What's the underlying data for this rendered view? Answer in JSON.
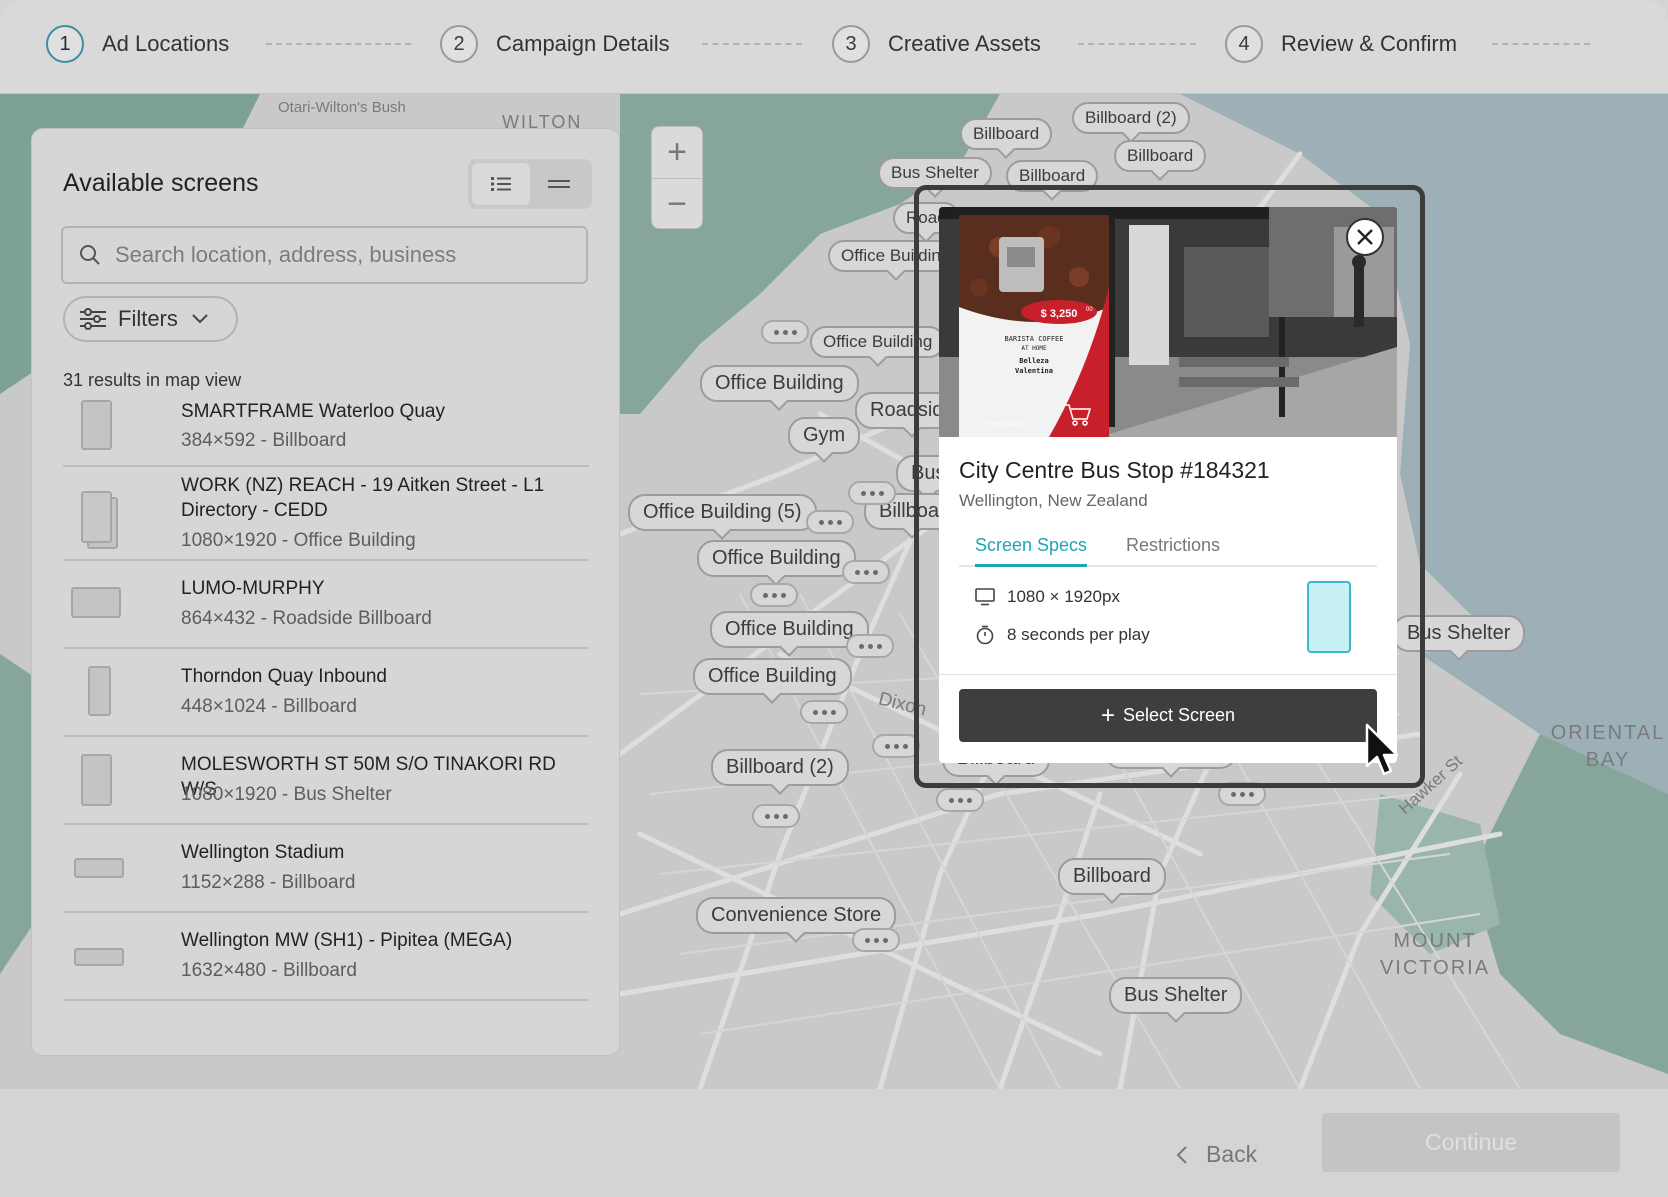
{
  "stepper": {
    "steps": [
      {
        "num": "1",
        "label": "Ad Locations"
      },
      {
        "num": "2",
        "label": "Campaign Details"
      },
      {
        "num": "3",
        "label": "Creative Assets"
      },
      {
        "num": "4",
        "label": "Review & Confirm"
      }
    ]
  },
  "map": {
    "area_labels": [
      "Otari-Wilton's Bush",
      "WILTON",
      "ORIENTAL BAY",
      "MOUNT VICTORIA",
      "Hawker St",
      "Dixon"
    ],
    "pins": [
      "Billboard (2)",
      "Billboard",
      "Billboard",
      "Bus Shelter",
      "Billboard",
      "Office Building",
      "Office Building",
      "Office Building",
      "Office Building (5)",
      "Office Building",
      "Office Building",
      "Office Building",
      "Gym",
      "Billboard (2)",
      "Billboard",
      "Bus Shelter",
      "Billboard",
      "Convenience Store",
      "Bus Shelter",
      "Bus Shelter",
      "Roadside",
      "Road",
      "Bus",
      "Billboar"
    ],
    "zoom_in": "+",
    "zoom_out": "−"
  },
  "sidebar": {
    "title": "Available screens",
    "search_placeholder": "Search location, address, business",
    "filters_label": "Filters",
    "results_count": "31 results in map view",
    "items": [
      {
        "name": "SMARTFRAME Waterloo Quay",
        "meta": "384×592 - Billboard"
      },
      {
        "name": "WORK (NZ) REACH - 19 Aitken Street - L1 Directory - CEDD",
        "meta": "1080×1920 - Office Building"
      },
      {
        "name": "LUMO-MURPHY",
        "meta": "864×432 - Roadside Billboard"
      },
      {
        "name": "Thorndon Quay Inbound",
        "meta": "448×1024 - Billboard"
      },
      {
        "name": "MOLESWORTH ST 50M S/O TINAKORI RD W/S",
        "meta": "1080×1920 - Bus Shelter"
      },
      {
        "name": "Wellington Stadium",
        "meta": "1152×288 - Billboard"
      },
      {
        "name": "Wellington MW (SH1) - Pipitea (MEGA)",
        "meta": "1632×480 - Billboard"
      }
    ]
  },
  "popup": {
    "title": "City Centre Bus Stop #184321",
    "subtitle": "Wellington, New Zealand",
    "tabs": [
      "Screen Specs",
      "Restrictions"
    ],
    "specs": {
      "resolution": "1080 × 1920px",
      "duration": "8 seconds per play"
    },
    "select_button": "Select Screen",
    "ad": {
      "price": "$ 3,250",
      "price_cents": "00",
      "line1": "BARISTA COFFEE",
      "line2": "AT HOME",
      "brand1": "Belleza",
      "brand2": "Valentina",
      "url": "myshop.demo"
    }
  },
  "footer": {
    "back_label": "Back",
    "continue_label": "Continue"
  },
  "colors": {
    "accent": "#1ea5b8",
    "primary_button": "#3e3e3e",
    "overlay": "#d4d4d4",
    "ad_red": "#c8202a"
  }
}
